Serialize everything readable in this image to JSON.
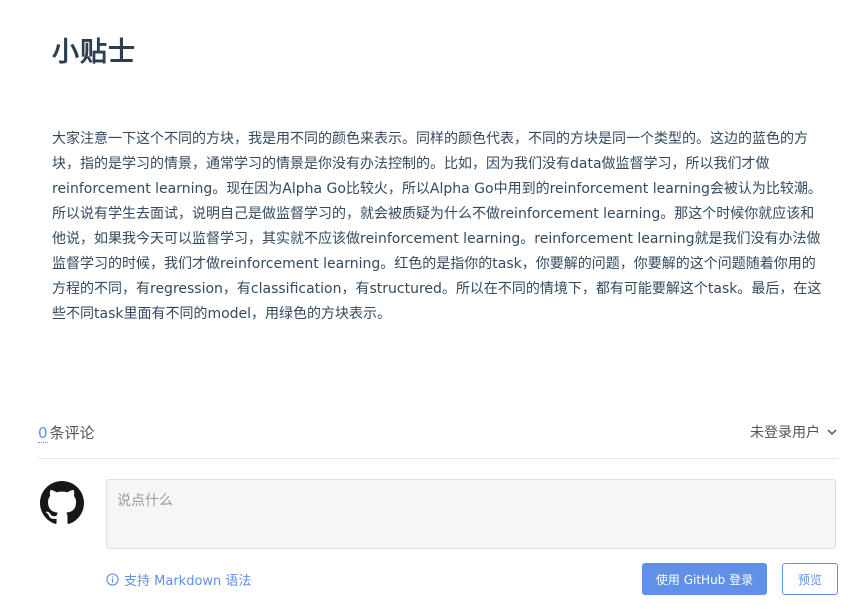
{
  "page": {
    "title": "小贴士",
    "body": "大家注意一下这个不同的方块，我是用不同的颜色来表示。同样的颜色代表，不同的方块是同一个类型的。这边的蓝色的方块，指的是学习的情景，通常学习的情景是你没有办法控制的。比如，因为我们没有data做监督学习，所以我们才做reinforcement learning。现在因为Alpha Go比较火，所以Alpha Go中用到的reinforcement learning会被认为比较潮。所以说有学生去面试，说明自己是做监督学习的，就会被质疑为什么不做reinforcement learning。那这个时候你就应该和他说，如果我今天可以监督学习，其实就不应该做reinforcement learning。reinforcement learning就是我们没有办法做监督学习的时候，我们才做reinforcement learning。红色的是指你的task，你要解的问题，你要解的这个问题随着你用的方程的不同，有regression，有classification，有structured。所以在不同的情境下，都有可能要解这个task。最后，在这些不同task里面有不同的model，用绿色的方块表示。"
  },
  "comments": {
    "count": "0",
    "count_label": "条评论",
    "user_label": "未登录用户",
    "placeholder": "说点什么",
    "markdown_hint": "支持 Markdown 语法",
    "login_button": "使用 GitHub 登录",
    "preview_button": "预览"
  },
  "colors": {
    "accent": "#6190e8",
    "title": "#2c3e50"
  },
  "icons": [
    "github-icon",
    "chevron-down-icon",
    "info-icon"
  ]
}
